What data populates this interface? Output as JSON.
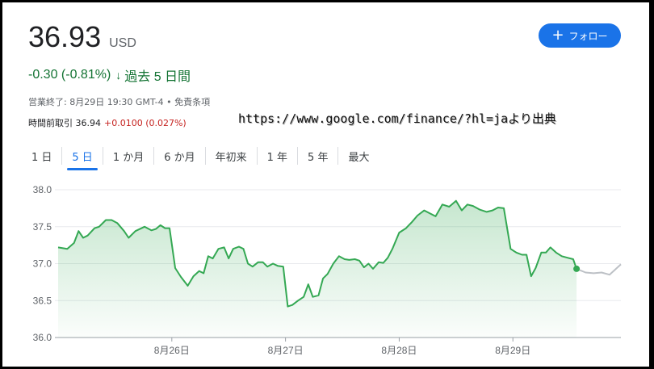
{
  "quote": {
    "price": "36.93",
    "currency": "USD",
    "change": "-0.30 (-0.81%)",
    "period": "過去 5 日間",
    "status": "営業終了: 8月29日 19:30 GMT-4 • 免責条項",
    "afterhours_label": "時間前取引 36.94",
    "afterhours_change": "+0.0100 (0.027%)"
  },
  "follow": {
    "label": "フォロー"
  },
  "watermark": "https://www.google.com/finance/?hl=jaより出典",
  "tabs": [
    "1 日",
    "5 日",
    "1 か月",
    "6 か月",
    "年初来",
    "1 年",
    "5 年",
    "最大"
  ],
  "active_tab": "5 日",
  "colors": {
    "up_line": "#34a853",
    "after_line": "#bdc1c6",
    "down_text": "#137333",
    "accent": "#1a73e8",
    "neg": "#c5221f"
  },
  "chart_data": {
    "type": "line",
    "ylim": [
      36.0,
      38.0
    ],
    "yticks": [
      "38.0",
      "37.5",
      "37.0",
      "36.5",
      "36.0"
    ],
    "xticks": [
      {
        "label": "8月26日",
        "x": 1.0
      },
      {
        "label": "8月27日",
        "x": 2.0
      },
      {
        "label": "8月28日",
        "x": 3.0
      },
      {
        "label": "8月29日",
        "x": 4.0
      }
    ],
    "xlim": [
      0.0,
      4.95
    ],
    "series": [
      {
        "values": [
          [
            0.0,
            37.22
          ],
          [
            0.08,
            37.2
          ],
          [
            0.14,
            37.28
          ],
          [
            0.18,
            37.44
          ],
          [
            0.22,
            37.35
          ],
          [
            0.26,
            37.38
          ],
          [
            0.32,
            37.48
          ],
          [
            0.36,
            37.5
          ],
          [
            0.42,
            37.59
          ],
          [
            0.47,
            37.59
          ],
          [
            0.52,
            37.55
          ],
          [
            0.58,
            37.44
          ],
          [
            0.62,
            37.35
          ],
          [
            0.68,
            37.44
          ],
          [
            0.76,
            37.5
          ],
          [
            0.82,
            37.45
          ],
          [
            0.86,
            37.47
          ],
          [
            0.9,
            37.52
          ],
          [
            0.94,
            37.48
          ],
          [
            0.98,
            37.48
          ],
          [
            1.03,
            36.94
          ],
          [
            1.08,
            36.82
          ],
          [
            1.14,
            36.7
          ],
          [
            1.19,
            36.83
          ],
          [
            1.24,
            36.9
          ],
          [
            1.28,
            36.87
          ],
          [
            1.32,
            37.1
          ],
          [
            1.36,
            37.07
          ],
          [
            1.41,
            37.2
          ],
          [
            1.46,
            37.22
          ],
          [
            1.5,
            37.07
          ],
          [
            1.54,
            37.2
          ],
          [
            1.59,
            37.23
          ],
          [
            1.63,
            37.2
          ],
          [
            1.67,
            37.0
          ],
          [
            1.71,
            36.96
          ],
          [
            1.76,
            37.02
          ],
          [
            1.8,
            37.02
          ],
          [
            1.84,
            36.96
          ],
          [
            1.89,
            37.0
          ],
          [
            1.93,
            36.97
          ],
          [
            1.98,
            36.96
          ],
          [
            2.02,
            36.42
          ],
          [
            2.06,
            36.44
          ],
          [
            2.11,
            36.5
          ],
          [
            2.16,
            36.55
          ],
          [
            2.2,
            36.72
          ],
          [
            2.24,
            36.55
          ],
          [
            2.29,
            36.57
          ],
          [
            2.33,
            36.8
          ],
          [
            2.37,
            36.86
          ],
          [
            2.42,
            37.0
          ],
          [
            2.47,
            37.1
          ],
          [
            2.52,
            37.06
          ],
          [
            2.56,
            37.05
          ],
          [
            2.61,
            37.06
          ],
          [
            2.65,
            37.04
          ],
          [
            2.69,
            36.95
          ],
          [
            2.73,
            37.0
          ],
          [
            2.77,
            36.93
          ],
          [
            2.82,
            37.02
          ],
          [
            2.86,
            37.01
          ],
          [
            2.9,
            37.08
          ],
          [
            2.94,
            37.2
          ],
          [
            3.0,
            37.42
          ],
          [
            3.06,
            37.48
          ],
          [
            3.11,
            37.56
          ],
          [
            3.16,
            37.65
          ],
          [
            3.22,
            37.72
          ],
          [
            3.27,
            37.68
          ],
          [
            3.32,
            37.64
          ],
          [
            3.38,
            37.8
          ],
          [
            3.44,
            37.77
          ],
          [
            3.5,
            37.85
          ],
          [
            3.55,
            37.72
          ],
          [
            3.6,
            37.8
          ],
          [
            3.65,
            37.78
          ],
          [
            3.71,
            37.73
          ],
          [
            3.77,
            37.7
          ],
          [
            3.82,
            37.72
          ],
          [
            3.87,
            37.76
          ],
          [
            3.92,
            37.75
          ],
          [
            3.98,
            37.2
          ],
          [
            4.03,
            37.15
          ],
          [
            4.08,
            37.12
          ],
          [
            4.12,
            37.12
          ],
          [
            4.16,
            36.83
          ],
          [
            4.2,
            36.94
          ],
          [
            4.25,
            37.15
          ],
          [
            4.29,
            37.15
          ],
          [
            4.33,
            37.22
          ],
          [
            4.38,
            37.15
          ],
          [
            4.43,
            37.1
          ],
          [
            4.48,
            37.08
          ],
          [
            4.53,
            37.06
          ],
          [
            4.56,
            36.93
          ]
        ]
      },
      {
        "values": [
          [
            4.56,
            36.93
          ],
          [
            4.64,
            36.88
          ],
          [
            4.71,
            36.87
          ],
          [
            4.78,
            36.88
          ],
          [
            4.85,
            36.85
          ],
          [
            4.95,
            36.99
          ]
        ]
      }
    ]
  }
}
